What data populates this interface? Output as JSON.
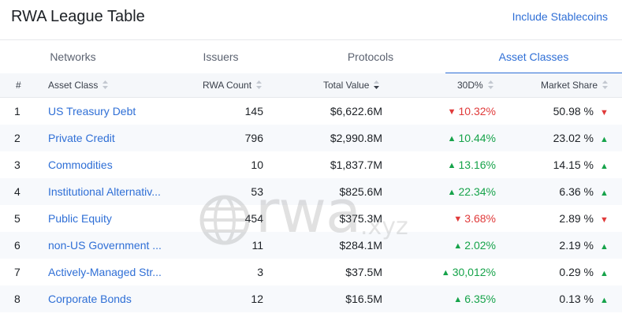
{
  "header": {
    "title": "RWA League Table",
    "stablecoins_link": "Include Stablecoins"
  },
  "tabs": [
    {
      "label": "Networks",
      "active": false
    },
    {
      "label": "Issuers",
      "active": false
    },
    {
      "label": "Protocols",
      "active": false
    },
    {
      "label": "Asset Classes",
      "active": true
    }
  ],
  "columns": {
    "index": "#",
    "asset_class": "Asset Class",
    "rwa_count": "RWA Count",
    "total_value": "Total Value",
    "change_30d": "30D%",
    "market_share": "Market Share"
  },
  "rows": [
    {
      "num": "1",
      "name": "US Treasury Debt",
      "count": "145",
      "value": "$6,622.6M",
      "change": "10.32%",
      "change_dir": "down",
      "share": "50.98 %",
      "share_dir": "down"
    },
    {
      "num": "2",
      "name": "Private Credit",
      "count": "796",
      "value": "$2,990.8M",
      "change": "10.44%",
      "change_dir": "up",
      "share": "23.02 %",
      "share_dir": "up"
    },
    {
      "num": "3",
      "name": "Commodities",
      "count": "10",
      "value": "$1,837.7M",
      "change": "13.16%",
      "change_dir": "up",
      "share": "14.15 %",
      "share_dir": "up"
    },
    {
      "num": "4",
      "name": "Institutional Alternativ...",
      "count": "53",
      "value": "$825.6M",
      "change": "22.34%",
      "change_dir": "up",
      "share": "6.36 %",
      "share_dir": "up"
    },
    {
      "num": "5",
      "name": "Public Equity",
      "count": "454",
      "value": "$375.3M",
      "change": "3.68%",
      "change_dir": "down",
      "share": "2.89 %",
      "share_dir": "down"
    },
    {
      "num": "6",
      "name": "non-US Government ...",
      "count": "11",
      "value": "$284.1M",
      "change": "2.02%",
      "change_dir": "up",
      "share": "2.19 %",
      "share_dir": "up"
    },
    {
      "num": "7",
      "name": "Actively-Managed Str...",
      "count": "3",
      "value": "$37.5M",
      "change": "30,012%",
      "change_dir": "up",
      "share": "0.29 %",
      "share_dir": "up"
    },
    {
      "num": "8",
      "name": "Corporate Bonds",
      "count": "12",
      "value": "$16.5M",
      "change": "6.35%",
      "change_dir": "up",
      "share": "0.13 %",
      "share_dir": "up"
    }
  ],
  "watermark": {
    "brand": "rwa",
    "suffix": ".xyz"
  },
  "colors": {
    "accent": "#2f6fd6",
    "up": "#16a34a",
    "down": "#e03a3a"
  }
}
